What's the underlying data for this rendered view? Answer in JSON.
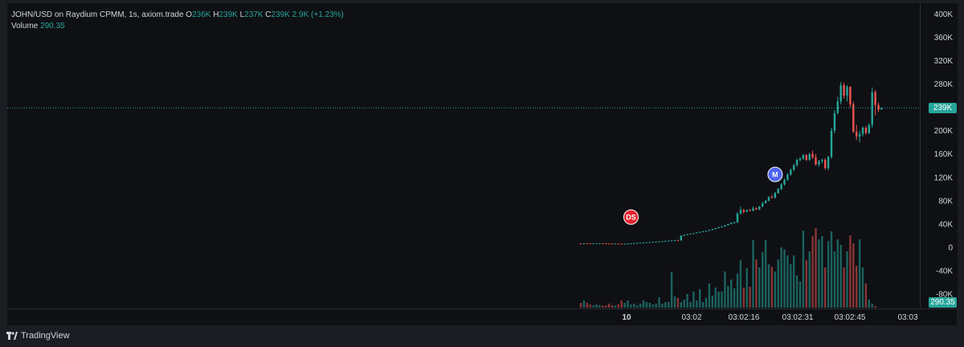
{
  "legend": {
    "symbol": "JOHN/USD on Raydium CPMM, 1s, axiom.trade",
    "o_label": "O",
    "o_value": "236K",
    "h_label": "H",
    "h_value": "239K",
    "l_label": "L",
    "l_value": "237K",
    "c_label": "C",
    "c_value": "239K",
    "change": "2.9K (+1.23%)",
    "volume_label": "Volume",
    "volume_value": "290.35"
  },
  "footer": {
    "brand": "TradingView",
    "logo_icon": "tradingview-logo-icon"
  },
  "colors": {
    "up": "#26a69a",
    "down": "#ef5350",
    "background": "#0f1014",
    "text": "#d1d4dc",
    "price_line": "#26a69a",
    "marker_ds": "#e5212e",
    "marker_m": "#4e63f0"
  },
  "chart_data": {
    "type": "candlestick",
    "price_axis": {
      "ticks": [
        "400K",
        "360K",
        "320K",
        "280K",
        "240K",
        "200K",
        "160K",
        "120K",
        "80K",
        "40K",
        "0",
        "-40K",
        "-80K"
      ],
      "tick_values": [
        400000,
        360000,
        320000,
        280000,
        240000,
        200000,
        160000,
        120000,
        80000,
        40000,
        0,
        -40000,
        -80000
      ],
      "ylim": [
        -110000,
        410000
      ],
      "last_price_label": "239K",
      "last_price": 239000,
      "volume_label": "290.35"
    },
    "time_axis": {
      "ticks": [
        "10",
        "03:02",
        "03:02:16",
        "03:02:31",
        "03:02:45",
        "03:03"
      ]
    },
    "markers": [
      {
        "label": "DS",
        "color": "#e5212e",
        "x_index": 15,
        "price": 52000
      },
      {
        "label": "M",
        "color": "#4e63f0",
        "x_index": 61,
        "price": 125000
      }
    ],
    "candles": [
      [
        7000,
        7000,
        6500,
        6800
      ],
      [
        6800,
        7100,
        6600,
        7000
      ],
      [
        7000,
        7200,
        6800,
        6900
      ],
      [
        6900,
        7000,
        6600,
        6700
      ],
      [
        6700,
        7000,
        6500,
        6900
      ],
      [
        6900,
        7100,
        6700,
        7000
      ],
      [
        7000,
        7200,
        6800,
        7100
      ],
      [
        7100,
        7200,
        6900,
        7000
      ],
      [
        7000,
        7100,
        6700,
        6800
      ],
      [
        6800,
        7000,
        6500,
        6600
      ],
      [
        6600,
        6800,
        6300,
        6400
      ],
      [
        6400,
        6700,
        6200,
        6500
      ],
      [
        6500,
        6700,
        6300,
        6400
      ],
      [
        6400,
        6600,
        6100,
        6200
      ],
      [
        6200,
        6500,
        6000,
        6300
      ],
      [
        6300,
        6700,
        6100,
        6600
      ],
      [
        6600,
        7100,
        6400,
        7000
      ],
      [
        7000,
        7600,
        6900,
        7400
      ],
      [
        7400,
        7900,
        7200,
        7800
      ],
      [
        7800,
        8300,
        7600,
        8100
      ],
      [
        8100,
        8600,
        7900,
        8400
      ],
      [
        8400,
        8900,
        8200,
        8700
      ],
      [
        8700,
        9400,
        8500,
        9100
      ],
      [
        9100,
        9700,
        8900,
        9500
      ],
      [
        9500,
        10200,
        9300,
        9900
      ],
      [
        9900,
        10600,
        9700,
        10300
      ],
      [
        10300,
        11000,
        10100,
        10700
      ],
      [
        10700,
        11400,
        10500,
        11100
      ],
      [
        11100,
        11800,
        10900,
        11500
      ],
      [
        11500,
        12300,
        11300,
        12000
      ],
      [
        12000,
        12800,
        11800,
        12400
      ],
      [
        12400,
        12900,
        11600,
        11900
      ],
      [
        11900,
        21000,
        11700,
        20000
      ],
      [
        20000,
        22000,
        19500,
        21500
      ],
      [
        21500,
        23000,
        21000,
        22500
      ],
      [
        22500,
        24000,
        22000,
        23500
      ],
      [
        23500,
        25000,
        23000,
        24500
      ],
      [
        24500,
        26000,
        24000,
        25500
      ],
      [
        25500,
        27000,
        25000,
        26600
      ],
      [
        26600,
        28000,
        26000,
        27500
      ],
      [
        27500,
        29000,
        26800,
        28500
      ],
      [
        28500,
        30500,
        28000,
        30000
      ],
      [
        30000,
        32000,
        29500,
        31500
      ],
      [
        31500,
        33500,
        31000,
        33000
      ],
      [
        33000,
        35000,
        32500,
        34500
      ],
      [
        34500,
        36500,
        34000,
        36000
      ],
      [
        36000,
        38500,
        35500,
        38000
      ],
      [
        38000,
        40500,
        37500,
        40000
      ],
      [
        40000,
        43000,
        39500,
        42000
      ],
      [
        42000,
        44000,
        41000,
        43000
      ],
      [
        43000,
        60000,
        42000,
        58000
      ],
      [
        58000,
        70000,
        56000,
        64000
      ],
      [
        64000,
        66000,
        58000,
        61000
      ],
      [
        61000,
        65000,
        60000,
        64000
      ],
      [
        64000,
        66000,
        62000,
        63000
      ],
      [
        63000,
        70000,
        62000,
        67000
      ],
      [
        67000,
        69000,
        64000,
        65000
      ],
      [
        65000,
        71000,
        64000,
        70000
      ],
      [
        70000,
        78000,
        69000,
        76000
      ],
      [
        76000,
        81000,
        75000,
        80000
      ],
      [
        80000,
        88000,
        79000,
        86000
      ],
      [
        86000,
        90000,
        84000,
        85000
      ],
      [
        85000,
        95000,
        84000,
        93000
      ],
      [
        93000,
        102000,
        92000,
        100000
      ],
      [
        100000,
        110000,
        98000,
        108000
      ],
      [
        108000,
        118000,
        106000,
        116000
      ],
      [
        116000,
        127000,
        114000,
        125000
      ],
      [
        125000,
        135000,
        123000,
        133000
      ],
      [
        133000,
        143000,
        131000,
        141000
      ],
      [
        141000,
        152000,
        138000,
        150000
      ],
      [
        150000,
        155000,
        147000,
        152000
      ],
      [
        152000,
        160000,
        150000,
        158000
      ],
      [
        158000,
        160000,
        148000,
        150000
      ],
      [
        150000,
        162000,
        148000,
        160000
      ],
      [
        160000,
        166000,
        152000,
        154000
      ],
      [
        154000,
        160000,
        140000,
        142000
      ],
      [
        142000,
        150000,
        138000,
        148000
      ],
      [
        148000,
        152000,
        144000,
        150000
      ],
      [
        150000,
        153000,
        133000,
        136000
      ],
      [
        136000,
        157000,
        132000,
        155000
      ],
      [
        155000,
        205000,
        152000,
        200000
      ],
      [
        200000,
        235000,
        195000,
        230000
      ],
      [
        230000,
        258000,
        228000,
        250000
      ],
      [
        250000,
        283000,
        245000,
        278000
      ],
      [
        278000,
        282000,
        255000,
        260000
      ],
      [
        260000,
        278000,
        250000,
        275000
      ],
      [
        275000,
        276000,
        240000,
        245000
      ],
      [
        245000,
        250000,
        196000,
        198000
      ],
      [
        198000,
        210000,
        184000,
        190000
      ],
      [
        190000,
        200000,
        180000,
        194000
      ],
      [
        194000,
        207000,
        190000,
        205000
      ],
      [
        205000,
        208000,
        193000,
        196000
      ],
      [
        196000,
        212000,
        194000,
        210000
      ],
      [
        210000,
        274000,
        205000,
        266000
      ],
      [
        266000,
        270000,
        226000,
        244000
      ],
      [
        244000,
        248000,
        232000,
        236000
      ],
      [
        236000,
        239000,
        237000,
        239000
      ]
    ],
    "volumes": [
      12,
      18,
      12,
      8,
      6,
      8,
      6,
      5,
      5,
      10,
      6,
      5,
      8,
      18,
      12,
      18,
      8,
      10,
      6,
      10,
      18,
      14,
      12,
      8,
      10,
      26,
      10,
      14,
      14,
      88,
      28,
      24,
      14,
      20,
      34,
      14,
      40,
      18,
      46,
      14,
      24,
      60,
      30,
      50,
      40,
      40,
      90,
      54,
      70,
      48,
      85,
      118,
      50,
      98,
      52,
      168,
      120,
      100,
      138,
      168,
      108,
      102,
      90,
      120,
      150,
      145,
      130,
      108,
      130,
      80,
      65,
      192,
      118,
      140,
      178,
      198,
      170,
      178,
      100,
      166,
      190,
      140,
      170,
      156,
      100,
      140,
      180,
      160,
      104,
      170,
      100,
      60,
      20,
      10,
      4
    ],
    "volume_scale_max": 200
  }
}
